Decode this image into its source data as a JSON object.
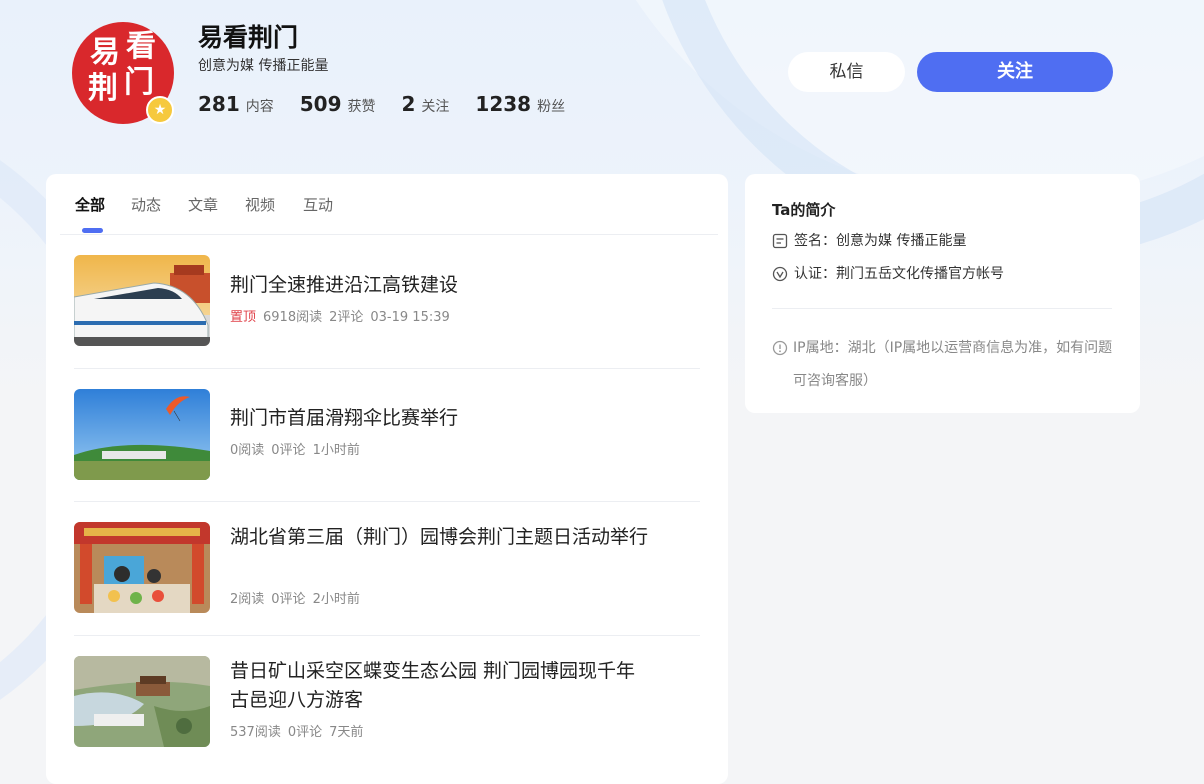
{
  "profile": {
    "avatar_text": [
      "易",
      "看",
      "荆",
      "门"
    ],
    "name": "易看荆门",
    "motto": "创意为媒 传播正能量",
    "stats": [
      {
        "num": "281",
        "label": "内容"
      },
      {
        "num": "509",
        "label": "获赞"
      },
      {
        "num": "2",
        "label": "关注"
      },
      {
        "num": "1238",
        "label": "粉丝"
      }
    ]
  },
  "actions": {
    "message_label": "私信",
    "follow_label": "关注"
  },
  "tabs": [
    {
      "label": "全部",
      "active": true
    },
    {
      "label": "动态",
      "active": false
    },
    {
      "label": "文章",
      "active": false
    },
    {
      "label": "视频",
      "active": false
    },
    {
      "label": "互动",
      "active": false
    }
  ],
  "feed": [
    {
      "title": "荆门全速推进沿江高铁建设",
      "pinned": "置顶",
      "reads": "6918阅读",
      "comments": "2评论",
      "time": "03-19 15:39",
      "thumb_icon": "high-speed-train-image"
    },
    {
      "title": "荆门市首届滑翔伞比赛举行",
      "pinned": "",
      "reads": "0阅读",
      "comments": "0评论",
      "time": "1小时前",
      "thumb_icon": "paraglider-image"
    },
    {
      "title": "湖北省第三届（荆门）园博会荆门主题日活动举行",
      "pinned": "",
      "reads": "2阅读",
      "comments": "0评论",
      "time": "2小时前",
      "thumb_icon": "market-stall-image"
    },
    {
      "title": "昔日矿山采空区蝶变生态公园 荆门园博园现千年古邑迎八方游客",
      "pinned": "",
      "reads": "537阅读",
      "comments": "0评论",
      "time": "7天前",
      "thumb_icon": "park-aerial-image"
    }
  ],
  "intro": {
    "title": "Ta的简介",
    "signature": "签名：创意为媒 传播正能量",
    "verification": "认证：荆门五岳文化传播官方帐号",
    "ip_note": "IP属地：湖北（IP属地以运营商信息为准，如有问题可咨询客服）"
  },
  "colors": {
    "accent": "#4f6ef2",
    "pin": "#e0424a",
    "avatar_bg": "#d9282c"
  }
}
